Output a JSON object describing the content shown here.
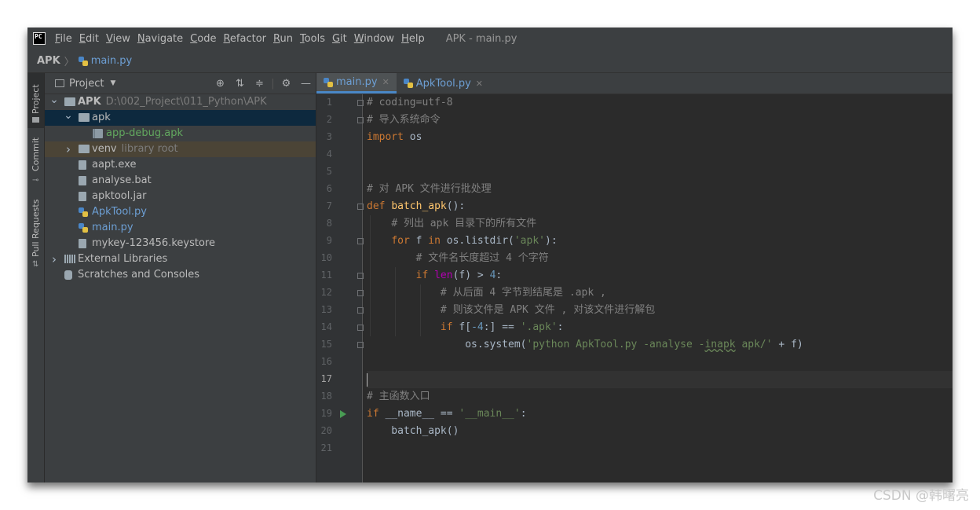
{
  "app": {
    "logo": "PC",
    "window_title": "APK - main.py"
  },
  "menu": [
    {
      "u": "F",
      "rest": "ile"
    },
    {
      "u": "E",
      "rest": "dit"
    },
    {
      "u": "V",
      "rest": "iew"
    },
    {
      "u": "N",
      "rest": "avigate"
    },
    {
      "u": "C",
      "rest": "ode"
    },
    {
      "u": "R",
      "rest": "efactor"
    },
    {
      "u": "R",
      "rest": "un"
    },
    {
      "u": "T",
      "rest": "ools"
    },
    {
      "u": "G",
      "rest": "it"
    },
    {
      "u": "W",
      "rest": "indow"
    },
    {
      "u": "H",
      "rest": "elp"
    }
  ],
  "breadcrumb": {
    "root": "APK",
    "file": "main.py"
  },
  "stripe": {
    "project": "Project",
    "commit": "Commit",
    "pull_requests": "Pull Requests"
  },
  "project_panel": {
    "view_label": "Project",
    "icons": [
      "locate-icon",
      "expand-all-icon",
      "collapse-all-icon",
      "gear-icon",
      "minimize-icon"
    ],
    "tree": [
      {
        "level": 0,
        "arrow": "down",
        "icon": "folder",
        "label": "APK",
        "bold": true,
        "extra": "D:\\002_Project\\011_Python\\APK"
      },
      {
        "level": 1,
        "arrow": "down",
        "icon": "folder",
        "label": "apk",
        "selected": true
      },
      {
        "level": 2,
        "arrow": "",
        "icon": "apk",
        "label": "app-debug.apk",
        "color": "green"
      },
      {
        "level": 1,
        "arrow": "right",
        "icon": "folder",
        "label": "venv",
        "extra": "library root",
        "venv": true
      },
      {
        "level": 1,
        "arrow": "",
        "icon": "file",
        "label": "aapt.exe"
      },
      {
        "level": 1,
        "arrow": "",
        "icon": "file",
        "label": "analyse.bat"
      },
      {
        "level": 1,
        "arrow": "",
        "icon": "file",
        "label": "apktool.jar"
      },
      {
        "level": 1,
        "arrow": "",
        "icon": "py",
        "label": "ApkTool.py",
        "color": "blue"
      },
      {
        "level": 1,
        "arrow": "",
        "icon": "py",
        "label": "main.py",
        "color": "blue"
      },
      {
        "level": 1,
        "arrow": "",
        "icon": "file",
        "label": "mykey-123456.keystore"
      },
      {
        "level": 0,
        "arrow": "right",
        "icon": "lib",
        "label": "External Libraries"
      },
      {
        "level": 0,
        "arrow": "",
        "icon": "scratch",
        "label": "Scratches and Consoles"
      }
    ]
  },
  "tabs": [
    {
      "label": "main.py",
      "active": true
    },
    {
      "label": "ApkTool.py",
      "active": false
    }
  ],
  "current_line": 17,
  "code": [
    [
      [
        "c-com",
        "# coding=utf-8"
      ]
    ],
    [
      [
        "c-com",
        "# 导入系统命令"
      ]
    ],
    [
      [
        "c-kw",
        "import"
      ],
      [
        "",
        " os"
      ]
    ],
    [],
    [],
    [
      [
        "c-com",
        "# 对 APK 文件进行批处理"
      ]
    ],
    [
      [
        "c-kw",
        "def"
      ],
      [
        "",
        " "
      ],
      [
        "c-fn",
        "batch_apk"
      ],
      [
        "",
        "():"
      ]
    ],
    [
      [
        "",
        "    "
      ],
      [
        "c-com",
        "# 列出 apk 目录下的所有文件"
      ]
    ],
    [
      [
        "",
        "    "
      ],
      [
        "c-kw",
        "for"
      ],
      [
        "",
        " f "
      ],
      [
        "c-kw",
        "in"
      ],
      [
        "",
        " os.listdir("
      ],
      [
        "c-str",
        "'apk'"
      ],
      [
        "",
        "):"
      ]
    ],
    [
      [
        "",
        "        "
      ],
      [
        "c-com",
        "# 文件名长度超过 4 个字符"
      ]
    ],
    [
      [
        "",
        "        "
      ],
      [
        "c-kw",
        "if"
      ],
      [
        "",
        " "
      ],
      [
        "c-mag",
        "len"
      ],
      [
        "",
        "(f) > "
      ],
      [
        "c-num",
        "4"
      ],
      [
        "",
        ":"
      ]
    ],
    [
      [
        "",
        "            "
      ],
      [
        "c-com",
        "# 从后面 4 字节到结尾是 .apk ,"
      ]
    ],
    [
      [
        "",
        "            "
      ],
      [
        "c-com",
        "# 则该文件是 APK 文件 , 对该文件进行解包"
      ]
    ],
    [
      [
        "",
        "            "
      ],
      [
        "c-kw",
        "if"
      ],
      [
        "",
        " f["
      ],
      [
        "c-num",
        "-4"
      ],
      [
        "",
        ":] == "
      ],
      [
        "c-str",
        "'.apk'"
      ],
      [
        "",
        ":"
      ]
    ],
    [
      [
        "",
        "                os.system("
      ],
      [
        "c-str",
        "'python ApkTool.py -analyse -"
      ],
      [
        "c-str typo",
        "inapk"
      ],
      [
        "c-str",
        " apk/'"
      ],
      [
        "",
        " + f)"
      ]
    ],
    [],
    [],
    [
      [
        "c-com",
        "# 主函数入口"
      ]
    ],
    [
      [
        "c-kw",
        "if"
      ],
      [
        "",
        " __name__ == "
      ],
      [
        "c-str",
        "'__main__'"
      ],
      [
        "",
        ":"
      ]
    ],
    [
      [
        "",
        "    batch_apk()"
      ]
    ],
    []
  ],
  "folds": [
    1,
    2,
    7,
    9,
    11,
    12,
    13,
    14,
    15
  ],
  "run_line": 19,
  "watermark": "CSDN @韩曙亮"
}
